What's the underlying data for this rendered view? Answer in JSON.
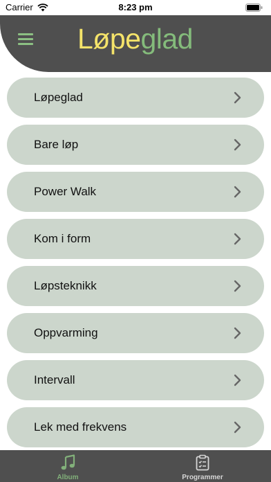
{
  "status_bar": {
    "carrier": "Carrier",
    "time": "8:23 pm"
  },
  "header": {
    "title_part1": "Løpe",
    "title_part2": "glad",
    "menu_icon": "hamburger-menu-icon"
  },
  "list": {
    "items": [
      {
        "label": "Løpeglad"
      },
      {
        "label": "Bare løp"
      },
      {
        "label": "Power Walk"
      },
      {
        "label": "Kom i form"
      },
      {
        "label": "Løpsteknikk"
      },
      {
        "label": "Oppvarming"
      },
      {
        "label": "Intervall"
      },
      {
        "label": "Lek med frekvens"
      }
    ]
  },
  "tab_bar": {
    "tabs": [
      {
        "label": "Album",
        "icon": "music-note-icon",
        "selected": true
      },
      {
        "label": "Programmer",
        "icon": "clipboard-list-icon",
        "selected": false
      }
    ]
  },
  "colors": {
    "header_bg": "#4f4f4f",
    "title_yellow": "#f4e36a",
    "title_green": "#84bb7b",
    "list_item_bg": "#ccd6cc",
    "tab_selected": "#82b07a"
  }
}
